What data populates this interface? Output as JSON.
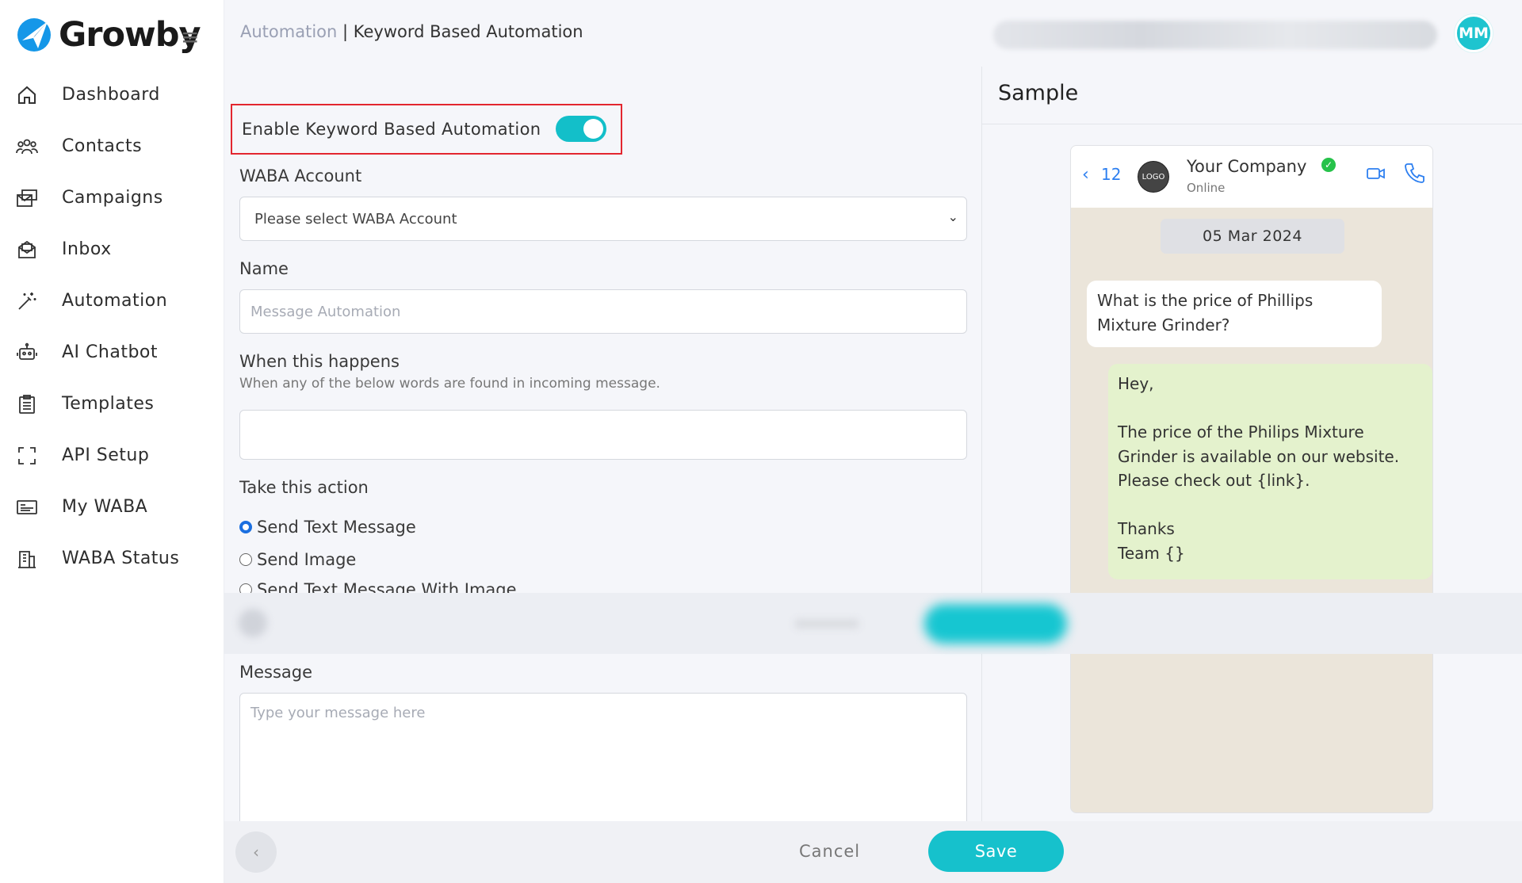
{
  "brand": {
    "name": "Growby"
  },
  "sidebar": {
    "items": [
      {
        "label": "Dashboard",
        "icon": "home-icon"
      },
      {
        "label": "Contacts",
        "icon": "people-icon"
      },
      {
        "label": "Campaigns",
        "icon": "campaign-icon"
      },
      {
        "label": "Inbox",
        "icon": "inbox-icon"
      },
      {
        "label": "Automation",
        "icon": "magic-wand-icon"
      },
      {
        "label": "AI Chatbot",
        "icon": "robot-icon"
      },
      {
        "label": "Templates",
        "icon": "clipboard-icon"
      },
      {
        "label": "API Setup",
        "icon": "scan-frame-icon"
      },
      {
        "label": "My WABA",
        "icon": "card-icon"
      },
      {
        "label": "WABA Status",
        "icon": "building-icon"
      }
    ]
  },
  "header": {
    "breadcrumb_root": "Automation",
    "separator": " | ",
    "breadcrumb_current": "Keyword Based Automation",
    "avatar_initials": "MM"
  },
  "form": {
    "enable_label": "Enable Keyword Based Automation",
    "enabled": true,
    "waba_label": "WABA Account",
    "waba_value": "Please select WABA Account",
    "name_label": "Name",
    "name_placeholder": "Message Automation",
    "trigger_label": "When this happens",
    "trigger_help": "When any of the below words are found in incoming message.",
    "action_label": "Take this action",
    "actions": [
      {
        "label": "Send Text Message",
        "selected": true
      },
      {
        "label": "Send Image",
        "selected": false
      },
      {
        "label": "Send Text Message With Image",
        "selected": false
      }
    ],
    "message_label": "Message",
    "message_placeholder": "Type your message here"
  },
  "sample": {
    "title": "Sample",
    "back_count": "12",
    "logo_text": "LOGO",
    "company": "Your Company",
    "status": "Online",
    "date": "05 Mar 2024",
    "incoming": "What is the price of Phillips Mixture Grinder?",
    "outgoing": "Hey,\n\nThe price of the Philips Mixture Grinder is available on our website. Please check out {link}.\n\nThanks\nTeam {}"
  },
  "footer": {
    "cancel": "Cancel",
    "save": "Save"
  },
  "colors": {
    "accent": "#13bfc9",
    "highlight_border": "#e3262f",
    "link": "#2d7ff0",
    "verified": "#26c24a"
  }
}
